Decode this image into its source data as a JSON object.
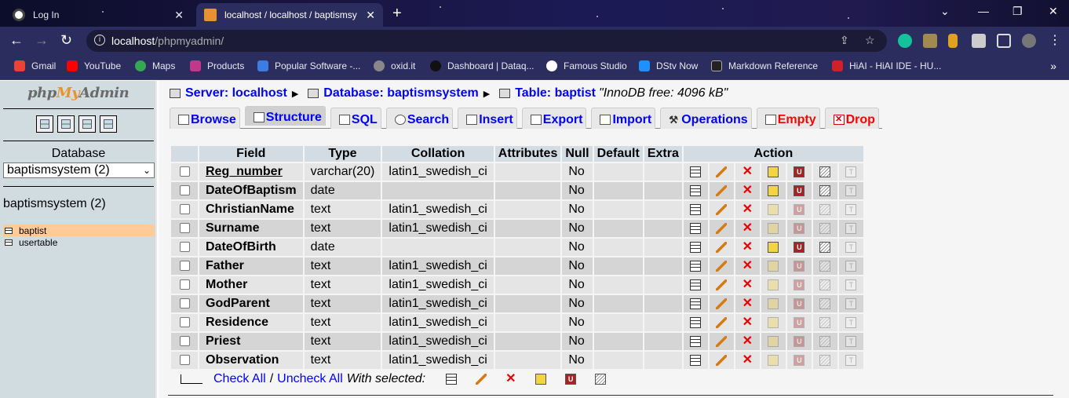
{
  "browser": {
    "tabs": [
      {
        "title": "Log In",
        "active": false
      },
      {
        "title": "localhost / localhost / baptismsy",
        "active": true
      }
    ],
    "url_host": "localhost",
    "url_path": "/phpmyadmin/",
    "bookmarks": [
      "Gmail",
      "YouTube",
      "Maps",
      "Products",
      "Popular Software -...",
      "oxid.it",
      "Dashboard | Dataq...",
      "Famous Studio",
      "DStv Now",
      "Markdown Reference",
      "HiAI - HiAI IDE - HU..."
    ]
  },
  "nav": {
    "logo_php": "php",
    "logo_my": "My",
    "logo_admin": "Admin",
    "database_label": "Database",
    "database_select": "baptismsystem (2)",
    "db_title": "baptismsystem (2)",
    "tables": [
      {
        "name": "baptist",
        "active": true
      },
      {
        "name": "usertable",
        "active": false
      }
    ]
  },
  "breadcrumb": {
    "server": "Server: localhost",
    "database": "Database: baptismsystem",
    "table": "Table: baptist",
    "info": "\"InnoDB free: 4096 kB\""
  },
  "tabs": [
    "Browse",
    "Structure",
    "SQL",
    "Search",
    "Insert",
    "Export",
    "Import",
    "Operations",
    "Empty",
    "Drop"
  ],
  "active_tab": "Structure",
  "table": {
    "headers": [
      "Field",
      "Type",
      "Collation",
      "Attributes",
      "Null",
      "Default",
      "Extra",
      "Action"
    ],
    "rows": [
      {
        "field": "Reg_number",
        "type": "varchar(20)",
        "collation": "latin1_swedish_ci",
        "attributes": "",
        "null": "No",
        "default": "",
        "extra": "",
        "primary": true
      },
      {
        "field": "DateOfBaptism",
        "type": "date",
        "collation": "",
        "attributes": "",
        "null": "No",
        "default": "",
        "extra": ""
      },
      {
        "field": "ChristianName",
        "type": "text",
        "collation": "latin1_swedish_ci",
        "attributes": "",
        "null": "No",
        "default": "",
        "extra": ""
      },
      {
        "field": "Surname",
        "type": "text",
        "collation": "latin1_swedish_ci",
        "attributes": "",
        "null": "No",
        "default": "",
        "extra": ""
      },
      {
        "field": "DateOfBirth",
        "type": "date",
        "collation": "",
        "attributes": "",
        "null": "No",
        "default": "",
        "extra": ""
      },
      {
        "field": "Father",
        "type": "text",
        "collation": "latin1_swedish_ci",
        "attributes": "",
        "null": "No",
        "default": "",
        "extra": ""
      },
      {
        "field": "Mother",
        "type": "text",
        "collation": "latin1_swedish_ci",
        "attributes": "",
        "null": "No",
        "default": "",
        "extra": ""
      },
      {
        "field": "GodParent",
        "type": "text",
        "collation": "latin1_swedish_ci",
        "attributes": "",
        "null": "No",
        "default": "",
        "extra": ""
      },
      {
        "field": "Residence",
        "type": "text",
        "collation": "latin1_swedish_ci",
        "attributes": "",
        "null": "No",
        "default": "",
        "extra": ""
      },
      {
        "field": "Priest",
        "type": "text",
        "collation": "latin1_swedish_ci",
        "attributes": "",
        "null": "No",
        "default": "",
        "extra": ""
      },
      {
        "field": "Observation",
        "type": "text",
        "collation": "latin1_swedish_ci",
        "attributes": "",
        "null": "No",
        "default": "",
        "extra": ""
      }
    ]
  },
  "footer": {
    "check_all": "Check All",
    "separator": "/",
    "uncheck_all": "Uncheck All",
    "with_selected": "With selected:"
  },
  "colors": {
    "link": "#0000ff",
    "danger": "#ff0000",
    "nav_bg": "#d0dce0",
    "header_bg": "#d3dce3",
    "selected_table": "#ffcc99"
  }
}
